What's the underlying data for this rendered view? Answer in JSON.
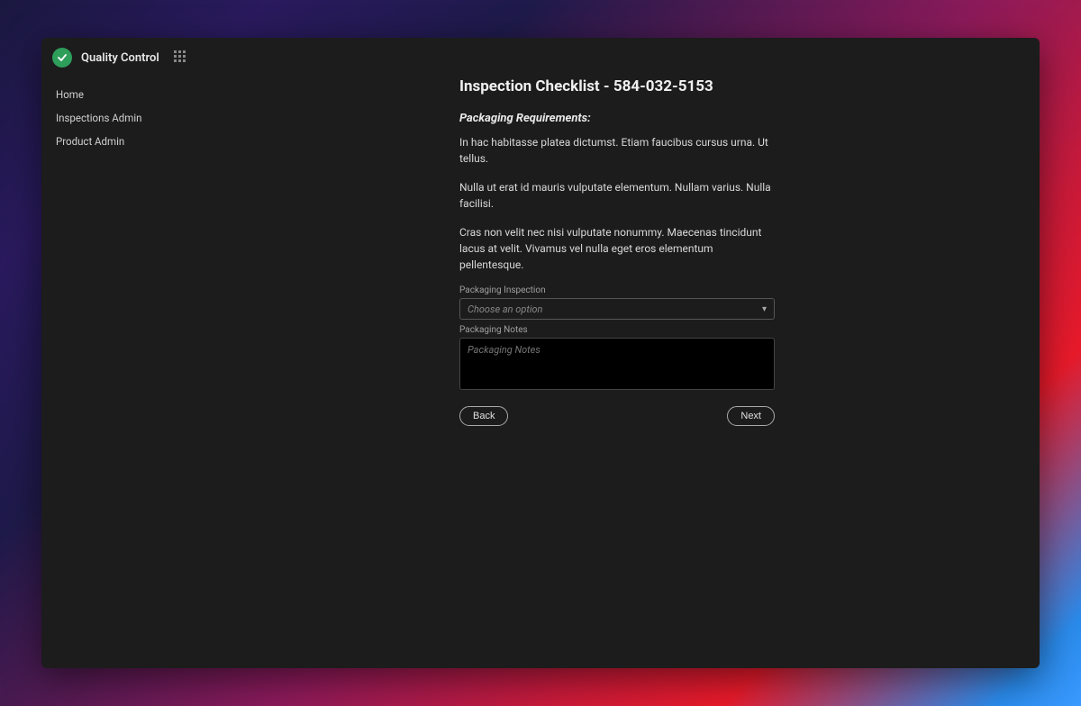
{
  "app": {
    "title": "Quality Control"
  },
  "nav": {
    "items": [
      {
        "label": "Home"
      },
      {
        "label": "Inspections Admin"
      },
      {
        "label": "Product Admin"
      }
    ]
  },
  "page": {
    "title": "Inspection Checklist - 584-032-5153",
    "section_title": "Packaging Requirements:",
    "paragraphs": [
      "In hac habitasse platea dictumst. Etiam faucibus cursus urna. Ut tellus.",
      "Nulla ut erat id mauris vulputate elementum. Nullam varius. Nulla facilisi.",
      "Cras non velit nec nisi vulputate nonummy. Maecenas tincidunt lacus at velit. Vivamus vel nulla eget eros elementum pellentesque."
    ],
    "fields": {
      "inspection_label": "Packaging Inspection",
      "inspection_placeholder": "Choose an option",
      "notes_label": "Packaging Notes",
      "notes_placeholder": "Packaging Notes"
    },
    "buttons": {
      "back": "Back",
      "next": "Next"
    }
  }
}
